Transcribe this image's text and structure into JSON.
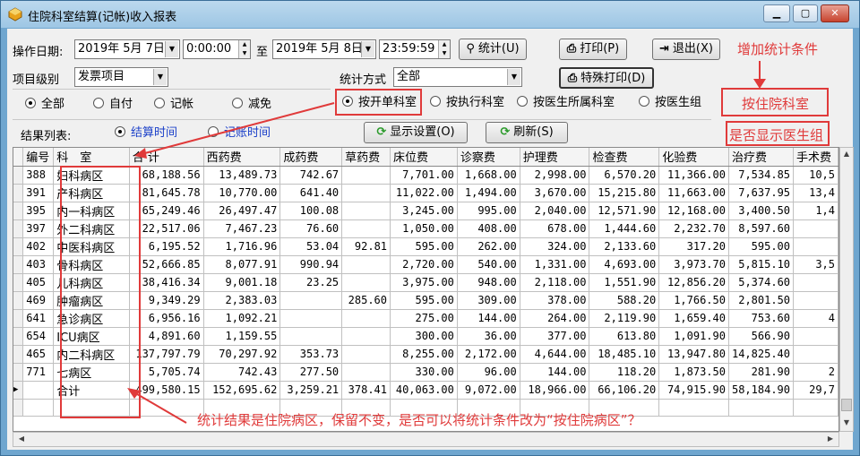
{
  "window": {
    "title": "住院科室结算(记帐)收入报表"
  },
  "filters": {
    "date_label": "操作日期:",
    "start_date": "2019年 5月 7日",
    "start_time": "0:00:00",
    "to_label": "至",
    "end_date": "2019年 5月 8日",
    "end_time": "23:59:59",
    "item_level_label": "项目级别",
    "item_level_value": "发票项目",
    "stat_mode_label": "统计方式",
    "stat_mode_value": "全部",
    "settle_options": [
      "全部",
      "自付",
      "记帐",
      "减免"
    ],
    "dept_options": [
      "按开单科室",
      "按执行科室",
      "按医生所属科室",
      "按医生组"
    ],
    "result_label": "结果列表:",
    "time_options": [
      "结算时间",
      "记账时间"
    ]
  },
  "buttons": {
    "stat": "统计(U)",
    "print": "打印(P)",
    "exit": "退出(X)",
    "special_print": "特殊打印(D)",
    "display_settings": "显示设置(O)",
    "refresh": "刷新(S)"
  },
  "annotations": {
    "add_condition": "增加统计条件",
    "by_ward": "按住院科室",
    "show_doctor_group": "是否显示医生组",
    "bottom_note": "统计结果是住院病区，保留不变，是否可以将统计条件改为“按住院病区”？"
  },
  "table": {
    "columns": [
      "编号",
      "科　室",
      "合 计",
      "西药费",
      "成药费",
      "草药费",
      "床位费",
      "诊察费",
      "护理费",
      "检查费",
      "化验费",
      "治疗费",
      "手术费"
    ],
    "rows": [
      [
        "388",
        "妇科病区",
        "68,188.56",
        "13,489.73",
        "742.67",
        "",
        "7,701.00",
        "1,668.00",
        "2,998.00",
        "6,570.20",
        "11,366.00",
        "7,534.85",
        "10,5"
      ],
      [
        "391",
        "产科病区",
        "81,645.78",
        "10,770.00",
        "641.40",
        "",
        "11,022.00",
        "1,494.00",
        "3,670.00",
        "15,215.80",
        "11,663.00",
        "7,637.95",
        "13,4"
      ],
      [
        "395",
        "内一科病区",
        "65,249.46",
        "26,497.47",
        "100.08",
        "",
        "3,245.00",
        "995.00",
        "2,040.00",
        "12,571.90",
        "12,168.00",
        "3,400.50",
        "1,4"
      ],
      [
        "397",
        "外二科病区",
        "22,517.06",
        "7,467.23",
        "76.60",
        "",
        "1,050.00",
        "408.00",
        "678.00",
        "1,444.60",
        "2,232.70",
        "8,597.60",
        ""
      ],
      [
        "402",
        "中医科病区",
        "6,195.52",
        "1,716.96",
        "53.04",
        "92.81",
        "595.00",
        "262.00",
        "324.00",
        "2,133.60",
        "317.20",
        "595.00",
        ""
      ],
      [
        "403",
        "骨科病区",
        "52,666.85",
        "8,077.91",
        "990.94",
        "",
        "2,720.00",
        "540.00",
        "1,331.00",
        "4,693.00",
        "3,973.70",
        "5,815.10",
        "3,5"
      ],
      [
        "405",
        "儿科病区",
        "38,416.34",
        "9,001.18",
        "23.25",
        "",
        "3,975.00",
        "948.00",
        "2,118.00",
        "1,551.90",
        "12,856.20",
        "5,374.60",
        ""
      ],
      [
        "469",
        "肿瘤病区",
        "9,349.29",
        "2,383.03",
        "",
        "285.60",
        "595.00",
        "309.00",
        "378.00",
        "588.20",
        "1,766.50",
        "2,801.50",
        ""
      ],
      [
        "641",
        "急诊病区",
        "6,956.16",
        "1,092.21",
        "",
        "",
        "275.00",
        "144.00",
        "264.00",
        "2,119.90",
        "1,659.40",
        "753.60",
        "4"
      ],
      [
        "654",
        "ICU病区",
        "4,891.60",
        "1,159.55",
        "",
        "",
        "300.00",
        "36.00",
        "377.00",
        "613.80",
        "1,091.90",
        "566.90",
        ""
      ],
      [
        "465",
        "内二科病区",
        "137,797.79",
        "70,297.92",
        "353.73",
        "",
        "8,255.00",
        "2,172.00",
        "4,644.00",
        "18,485.10",
        "13,947.80",
        "14,825.40",
        ""
      ],
      [
        "771",
        "七病区",
        "5,705.74",
        "742.43",
        "277.50",
        "",
        "330.00",
        "96.00",
        "144.00",
        "118.20",
        "1,873.50",
        "281.90",
        "2"
      ],
      [
        "",
        "合计",
        "499,580.15",
        "152,695.62",
        "3,259.21",
        "378.41",
        "40,063.00",
        "9,072.00",
        "18,966.00",
        "66,106.20",
        "74,915.90",
        "58,184.90",
        "29,7"
      ]
    ]
  }
}
